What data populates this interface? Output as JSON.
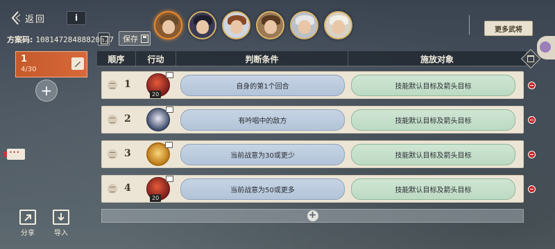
{
  "header": {
    "back_label": "返回",
    "info_label": "i",
    "plan_code_key": "方案码:",
    "plan_code_value": "10814728488820a27",
    "save_label": "保存",
    "more_label": "更多武将"
  },
  "avatars": [
    {
      "hair": "#6b4a2a",
      "bg": "#8a5a30"
    },
    {
      "hair": "#1e1e2e",
      "bg": "#3a3a55"
    },
    {
      "hair": "#8a4a2a",
      "bg": "#cfd6e0"
    },
    {
      "hair": "#5a3a22",
      "bg": "#9b7a55"
    },
    {
      "hair": "#e5e5ea",
      "bg": "#b9c0c8"
    },
    {
      "hair": "#f0efe8",
      "bg": "#d8d2c4"
    }
  ],
  "plan": {
    "number": "1",
    "count": "4/30"
  },
  "bottom": {
    "share_label": "分享",
    "import_label": "导入"
  },
  "table": {
    "headers": {
      "order": "顺序",
      "action": "行动",
      "condition": "判断条件",
      "target": "施放对象"
    },
    "rows": [
      {
        "index": "1",
        "skill": "red",
        "cost": "20",
        "condition": "自身的第1个回合",
        "target": "技能默认目标及箭头目标"
      },
      {
        "index": "2",
        "skill": "dark",
        "cost": "",
        "condition": "有吟唱中的敌方",
        "target": "技能默认目标及箭头目标"
      },
      {
        "index": "3",
        "skill": "gold",
        "cost": "",
        "condition": "当前战意为30或更少",
        "target": "技能默认目标及箭头目标"
      },
      {
        "index": "4",
        "skill": "red",
        "cost": "20",
        "condition": "当前战意为50或更多",
        "target": "技能默认目标及箭头目标"
      }
    ]
  },
  "add_row_label": "+"
}
